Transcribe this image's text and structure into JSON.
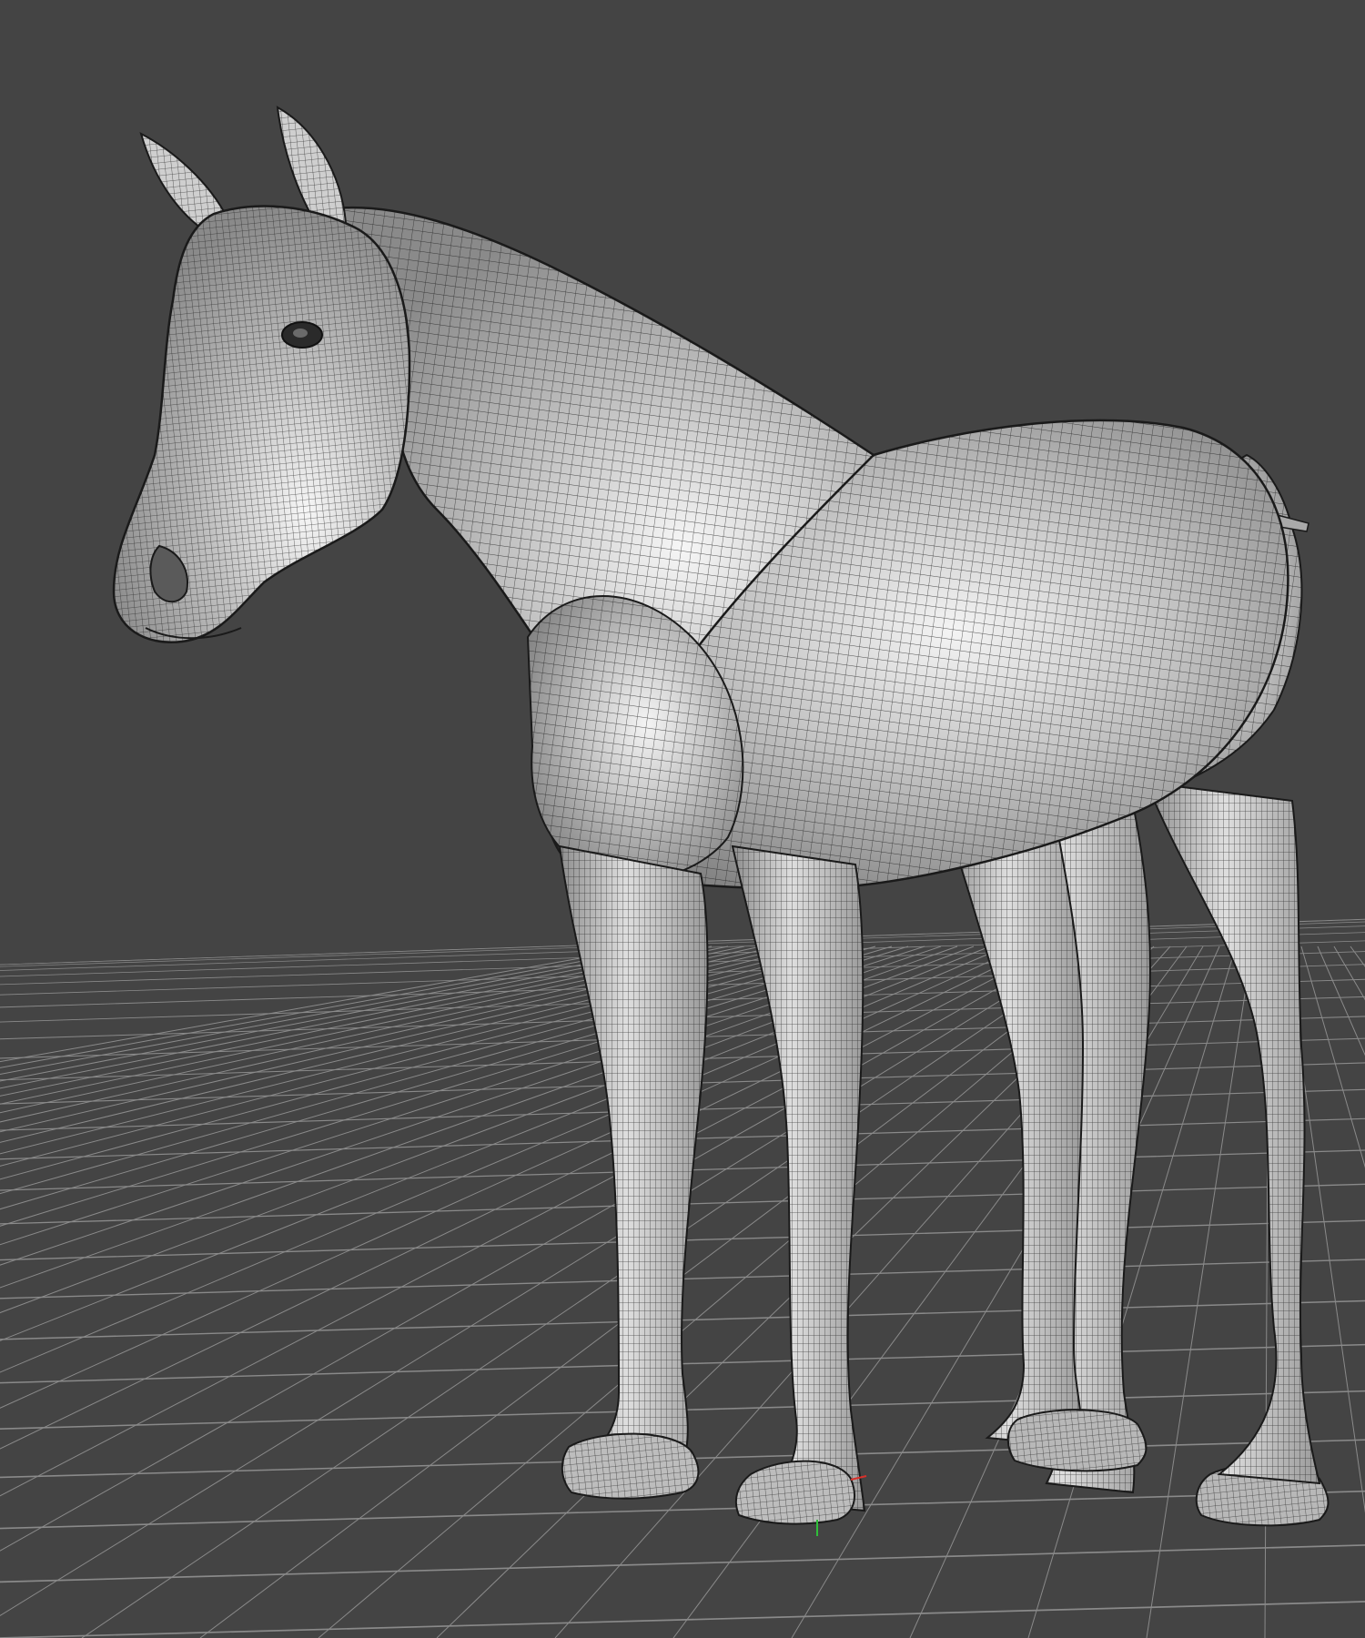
{
  "viewport": {
    "background_color": "#444444",
    "grid_color": "#8a8a8a",
    "grid_major_color": "#b9b9b9",
    "model_color": "#bdbdbd",
    "model_highlight": "#f2f2f2",
    "wire_color": "#1f1f1f",
    "axis_x_color": "#d8302a",
    "axis_y_color": "#2fbf3a"
  },
  "scene": {
    "object": "horse-wireframe-mesh",
    "shading": "smooth-shaded-with-wireframe",
    "grid_visible": true
  }
}
